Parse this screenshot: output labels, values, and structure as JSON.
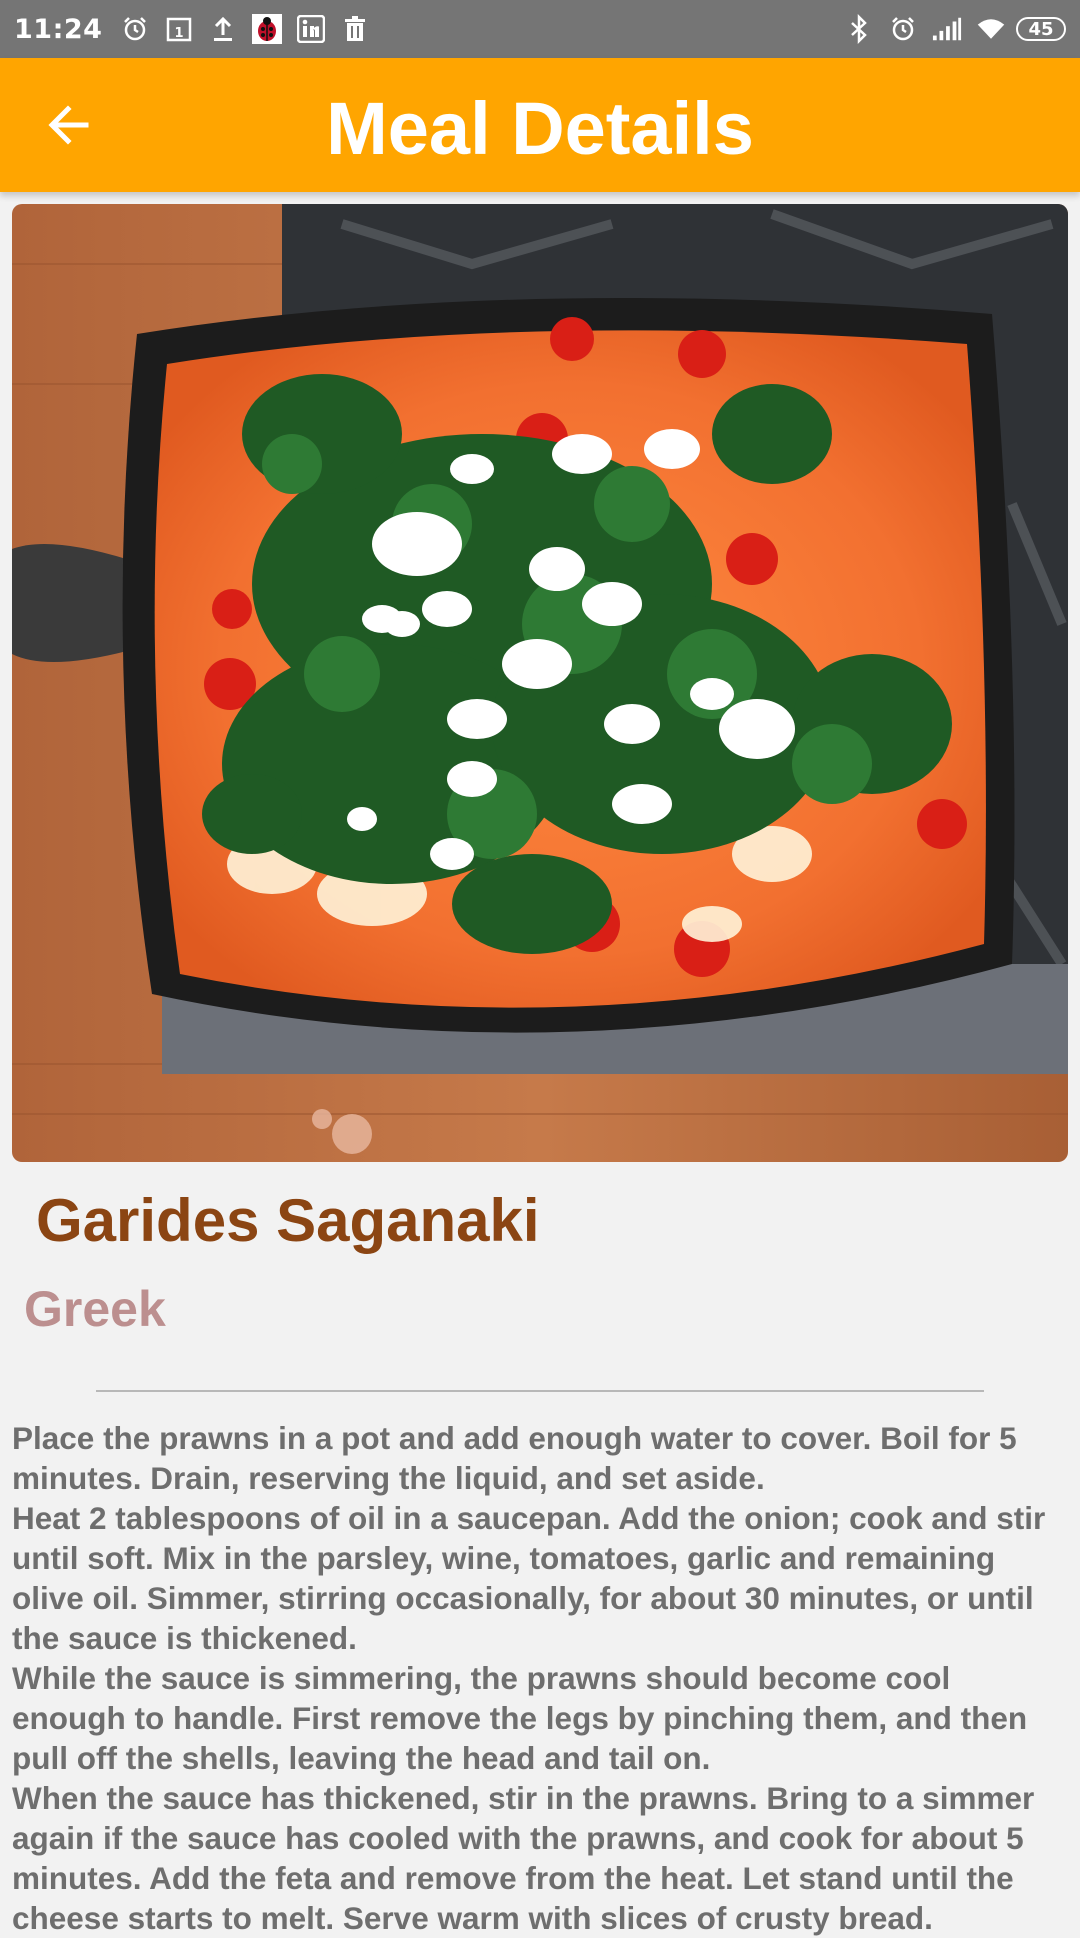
{
  "status_bar": {
    "time": "11:24",
    "battery": "45",
    "left_icons": [
      "alarm-icon",
      "calendar-icon",
      "upload-icon",
      "ladybug-icon",
      "linkedin-icon",
      "trash-icon"
    ],
    "right_icons": [
      "bluetooth-icon",
      "alarm-icon",
      "signal-icon",
      "wifi-icon",
      "battery-icon"
    ]
  },
  "app_bar": {
    "title": "Meal Details",
    "back_icon": "arrow-back-icon",
    "background": "#FFA500"
  },
  "meal": {
    "name": "Garides Saganaki",
    "area": "Greek",
    "name_color": "#8B4513",
    "area_color": "#BC8F8F",
    "instructions": "Place the prawns in a pot and add enough water to cover. Boil for 5 minutes. Drain, reserving the liquid, and set aside.\nHeat 2 tablespoons of oil in a saucepan. Add the onion; cook and stir until soft. Mix in the parsley, wine, tomatoes, garlic and remaining olive oil. Simmer, stirring occasionally, for about 30 minutes, or until the sauce is thickened.\nWhile the sauce is simmering, the prawns should become cool enough to handle. First remove the legs by pinching them, and then pull off the shells, leaving the head and tail on.\nWhen the sauce has thickened, stir in the prawns. Bring to a simmer again if the sauce has cooled with the prawns, and cook for about 5 minutes. Add the feta and remove from the heat. Let stand until the cheese starts to melt. Serve warm with slices of crusty bread."
  }
}
